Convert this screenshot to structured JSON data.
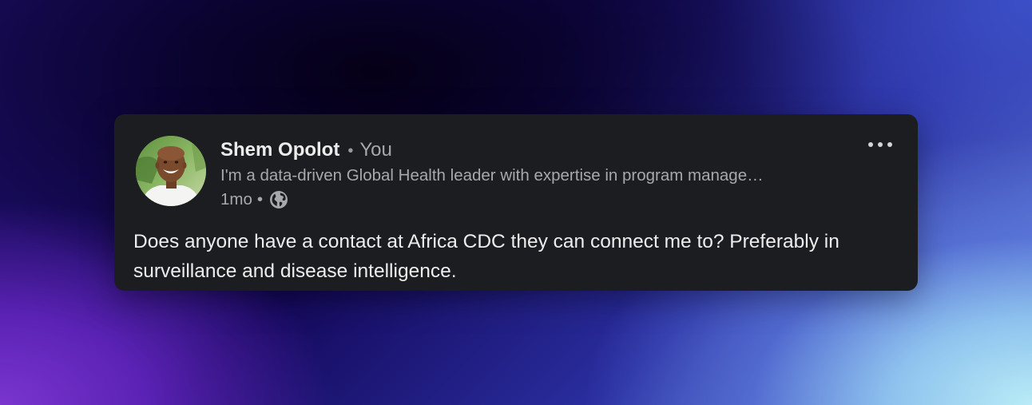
{
  "post": {
    "author_name": "Shem Opolot",
    "separator": "•",
    "relation": "You",
    "headline": "I'm a data-driven Global Health leader with expertise in program manage…",
    "time_ago": "1mo",
    "visibility_icon": "globe-icon",
    "more_icon": "more-horizontal-icon",
    "text": "Does anyone have a contact at Africa CDC they can connect me to? Preferably in surveillance and disease intelligence."
  },
  "colors": {
    "card_background": "#1c1d20",
    "primary_text": "#ececec",
    "secondary_text": "#a7a8ac"
  }
}
